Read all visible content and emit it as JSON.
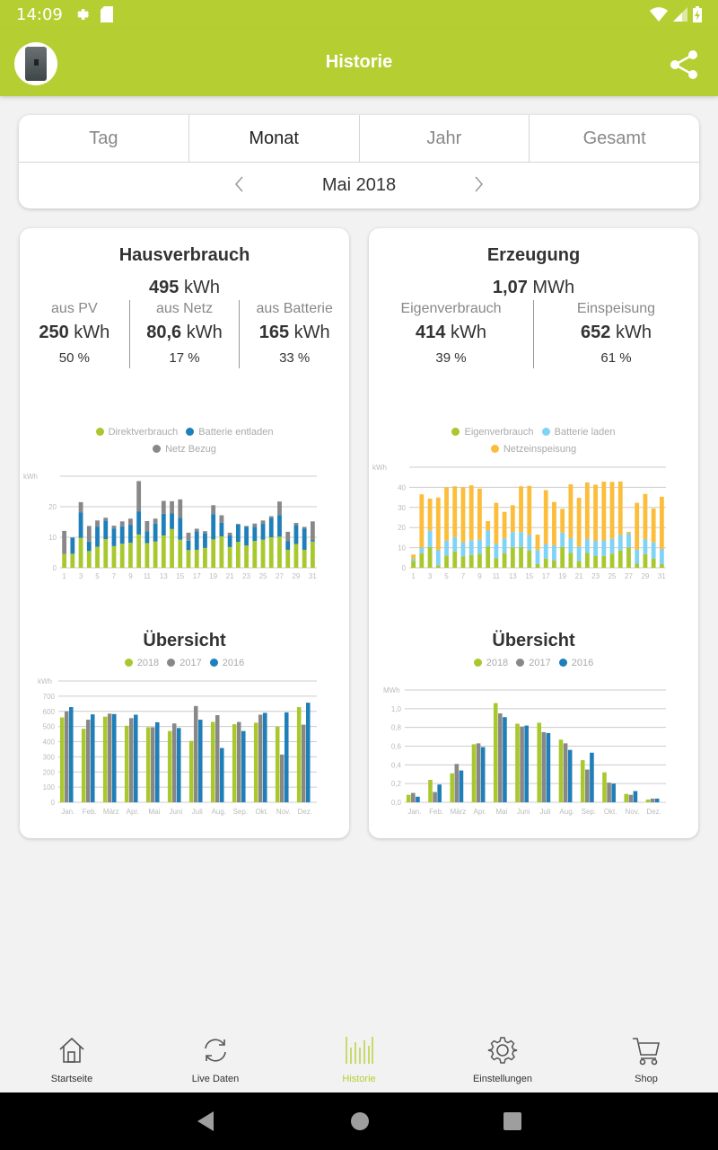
{
  "status_bar": {
    "time": "14:09"
  },
  "app_bar": {
    "title": "Historie"
  },
  "period": {
    "tabs": [
      {
        "label": "Tag",
        "active": false
      },
      {
        "label": "Monat",
        "active": true
      },
      {
        "label": "Jahr",
        "active": false
      },
      {
        "label": "Gesamt",
        "active": false
      }
    ],
    "current": "Mai 2018"
  },
  "hausverbrauch": {
    "title": "Hausverbrauch",
    "total_value": "495",
    "total_unit": "kWh",
    "stats": [
      {
        "label": "aus PV",
        "value": "250",
        "unit": "kWh",
        "percent": "50 %"
      },
      {
        "label": "aus Netz",
        "value": "80,6",
        "unit": "kWh",
        "percent": "17 %"
      },
      {
        "label": "aus Batterie",
        "value": "165",
        "unit": "kWh",
        "percent": "33 %"
      }
    ],
    "overview_title": "Übersicht"
  },
  "erzeugung": {
    "title": "Erzeugung",
    "total_value": "1,07",
    "total_unit": "MWh",
    "stats": [
      {
        "label": "Eigenverbrauch",
        "value": "414",
        "unit": "kWh",
        "percent": "39 %"
      },
      {
        "label": "Einspeisung",
        "value": "652",
        "unit": "kWh",
        "percent": "61 %"
      }
    ],
    "overview_title": "Übersicht"
  },
  "colors": {
    "accent": "#b5cf33",
    "green": "#a8c82e",
    "blue": "#1f7fb8",
    "gray": "#888888",
    "lightblue": "#7fd3f5",
    "orange": "#fbbd3a"
  },
  "chart_data": [
    {
      "id": "daily_consumption",
      "type": "bar",
      "stacked": true,
      "ylabel": "kWh",
      "ylim": [
        0,
        30
      ],
      "yticks": [
        0,
        10,
        20
      ],
      "grid": true,
      "legend_position": "top",
      "x": [
        1,
        2,
        3,
        4,
        5,
        6,
        7,
        8,
        9,
        10,
        11,
        12,
        13,
        14,
        15,
        16,
        17,
        18,
        19,
        20,
        21,
        22,
        23,
        24,
        25,
        26,
        27,
        28,
        29,
        30,
        31
      ],
      "xtick_labels": [
        "1",
        "3",
        "5",
        "7",
        "9",
        "11",
        "13",
        "15",
        "17",
        "19",
        "21",
        "23",
        "25",
        "27",
        "29",
        "31"
      ],
      "series": [
        {
          "name": "Direktverbrauch",
          "color": "#a8c82e",
          "values": [
            4.5,
            4.6,
            9.8,
            5.5,
            6.9,
            9.4,
            7.1,
            7.9,
            8.2,
            10.9,
            8.1,
            8.6,
            10.6,
            12.7,
            9.2,
            5.8,
            5.9,
            6.5,
            9.3,
            10.3,
            6.8,
            8.5,
            7.3,
            8.8,
            9.2,
            10.0,
            10.2,
            5.9,
            7.8,
            5.9,
            8.6
          ]
        },
        {
          "name": "Batterie entladen",
          "color": "#1f7fb8",
          "values": [
            0.0,
            5.3,
            8.4,
            3.1,
            6.6,
            6.1,
            5.7,
            5.7,
            5.9,
            7.6,
            3.8,
            5.9,
            7.1,
            5.1,
            7.2,
            3.1,
            6.1,
            4.8,
            8.3,
            4.5,
            3.8,
            5.7,
            6.2,
            4.6,
            5.2,
            6.3,
            7.1,
            2.9,
            6.2,
            6.9,
            0.5
          ]
        },
        {
          "name": "Netz Bezug",
          "color": "#888888",
          "values": [
            7.6,
            0.0,
            3.3,
            5.1,
            2.0,
            0.9,
            1.0,
            1.6,
            2.0,
            9.9,
            3.4,
            1.6,
            4.2,
            4.0,
            6.0,
            2.6,
            0.8,
            0.7,
            2.9,
            2.4,
            0.9,
            0.2,
            0.2,
            1.1,
            1.1,
            0.6,
            4.4,
            3.0,
            0.7,
            0.6,
            6.1
          ]
        }
      ]
    },
    {
      "id": "daily_generation",
      "type": "bar",
      "stacked": true,
      "ylabel": "kWh",
      "ylim": [
        0,
        50
      ],
      "yticks": [
        0,
        10,
        20,
        30,
        40
      ],
      "grid": true,
      "legend_position": "top",
      "x": [
        1,
        2,
        3,
        4,
        5,
        6,
        7,
        8,
        9,
        10,
        11,
        12,
        13,
        14,
        15,
        16,
        17,
        18,
        19,
        20,
        21,
        22,
        23,
        24,
        25,
        26,
        27,
        28,
        29,
        30,
        31
      ],
      "xtick_labels": [
        "1",
        "3",
        "5",
        "7",
        "9",
        "11",
        "13",
        "15",
        "17",
        "19",
        "21",
        "23",
        "25",
        "27",
        "29",
        "31"
      ],
      "series": [
        {
          "name": "Eigenverbrauch",
          "color": "#a8c82e",
          "values": [
            3.5,
            7.2,
            10.3,
            1.2,
            6.0,
            8.1,
            5.6,
            6.3,
            7.0,
            10.5,
            4.7,
            7.3,
            10.2,
            10.4,
            8.5,
            1.8,
            4.6,
            3.6,
            10.3,
            7.4,
            3.3,
            7.4,
            5.8,
            5.9,
            7.0,
            8.6,
            10.1,
            2.0,
            6.8,
            4.6,
            1.8
          ]
        },
        {
          "name": "Batterie laden",
          "color": "#7fd3f5",
          "values": [
            1.0,
            2.8,
            8.1,
            7.5,
            7.5,
            7.2,
            7.1,
            7.4,
            7.0,
            8.0,
            7.3,
            7.3,
            7.6,
            7.4,
            7.8,
            7.0,
            7.2,
            7.6,
            7.2,
            7.4,
            7.3,
            6.9,
            7.6,
            7.7,
            7.4,
            7.7,
            7.0,
            7.1,
            7.3,
            8.0,
            7.6
          ]
        },
        {
          "name": "Netzeinspeisung",
          "color": "#fbbd3a",
          "values": [
            2.1,
            26.5,
            16.0,
            26.2,
            26.5,
            25.2,
            27.3,
            27.3,
            25.4,
            4.7,
            20.3,
            13.2,
            13.3,
            22.7,
            24.4,
            7.7,
            26.8,
            21.5,
            11.8,
            26.7,
            24.2,
            28.1,
            27.9,
            29.2,
            28.3,
            26.6,
            0.8,
            23.2,
            22.6,
            16.9,
            25.9
          ]
        }
      ]
    },
    {
      "id": "overview_consumption",
      "type": "bar",
      "title": "Übersicht",
      "ylabel": "kWh",
      "ylim": [
        0,
        800
      ],
      "yticks": [
        0,
        100,
        200,
        300,
        400,
        500,
        600,
        700
      ],
      "grid": true,
      "legend_position": "top",
      "categories": [
        "Jan.",
        "Feb.",
        "März",
        "Apr.",
        "Mai",
        "Juni",
        "Juli",
        "Aug.",
        "Sep.",
        "Okt.",
        "Nov.",
        "Dez."
      ],
      "series": [
        {
          "name": "2018",
          "color": "#a8c82e",
          "values": [
            560,
            485,
            565,
            505,
            495,
            470,
            405,
            530,
            515,
            525,
            500,
            628
          ]
        },
        {
          "name": "2017",
          "color": "#888888",
          "values": [
            600,
            545,
            585,
            555,
            495,
            520,
            635,
            575,
            530,
            578,
            315,
            512
          ]
        },
        {
          "name": "2016",
          "color": "#1f7fb8",
          "values": [
            628,
            580,
            582,
            578,
            528,
            490,
            545,
            358,
            470,
            590,
            593,
            657
          ]
        }
      ]
    },
    {
      "id": "overview_generation",
      "type": "bar",
      "title": "Übersicht",
      "ylabel": "MWh",
      "ylim": [
        0,
        1.2
      ],
      "yticks": [
        "0,0",
        "0,2",
        "0,4",
        "0,6",
        "0,8",
        "1,0"
      ],
      "grid": true,
      "legend_position": "top",
      "categories": [
        "Jan.",
        "Feb.",
        "März",
        "Apr.",
        "Mai",
        "Juni",
        "Juli",
        "Aug.",
        "Sep.",
        "Okt.",
        "Nov.",
        "Dez."
      ],
      "series": [
        {
          "name": "2018",
          "color": "#a8c82e",
          "values": [
            0.08,
            0.24,
            0.31,
            0.62,
            1.06,
            0.84,
            0.85,
            0.67,
            0.45,
            0.32,
            0.09,
            0.03
          ]
        },
        {
          "name": "2017",
          "color": "#888888",
          "values": [
            0.1,
            0.11,
            0.41,
            0.63,
            0.95,
            0.81,
            0.75,
            0.63,
            0.35,
            0.21,
            0.08,
            0.04
          ]
        },
        {
          "name": "2016",
          "color": "#1f7fb8",
          "values": [
            0.06,
            0.19,
            0.34,
            0.59,
            0.91,
            0.82,
            0.74,
            0.56,
            0.53,
            0.2,
            0.12,
            0.04
          ]
        }
      ]
    }
  ],
  "bottom_nav": {
    "items": [
      {
        "label": "Startseite",
        "icon": "home-icon",
        "active": false
      },
      {
        "label": "Live Daten",
        "icon": "refresh-icon",
        "active": false
      },
      {
        "label": "Historie",
        "icon": "history-bars-icon",
        "active": true
      },
      {
        "label": "Einstellungen",
        "icon": "gear-icon",
        "active": false
      },
      {
        "label": "Shop",
        "icon": "cart-icon",
        "active": false
      }
    ]
  }
}
